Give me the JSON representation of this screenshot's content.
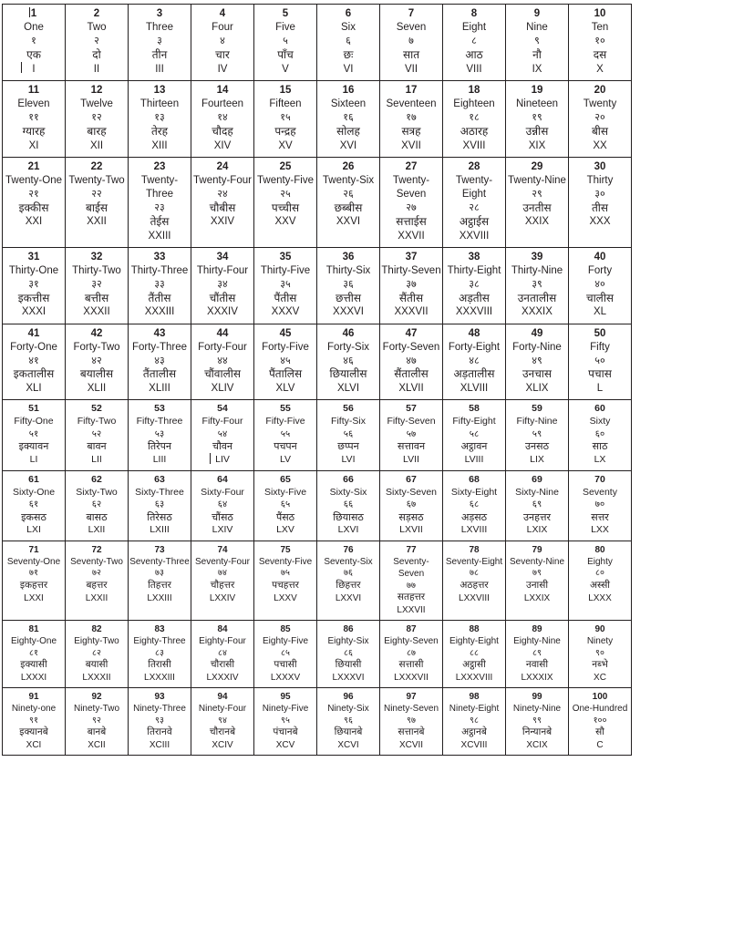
{
  "document": {
    "title": "Numbers 1 to 100 — English, Devanagari, Hindi, Roman",
    "columns_per_row": 10,
    "lines_per_cell": [
      "number",
      "english",
      "devanagari",
      "hindi",
      "roman"
    ]
  },
  "rows": [
    {
      "band": "s",
      "cells": [
        {
          "number": "1",
          "english": "One",
          "devanagari": "१",
          "hindi": "एक",
          "roman": "I",
          "caret": "number"
        },
        {
          "number": "2",
          "english": "Two",
          "devanagari": "२",
          "hindi": "दो",
          "roman": "II"
        },
        {
          "number": "3",
          "english": "Three",
          "devanagari": "३",
          "hindi": "तीन",
          "roman": "III"
        },
        {
          "number": "4",
          "english": "Four",
          "devanagari": "४",
          "hindi": "चार",
          "roman": "IV"
        },
        {
          "number": "5",
          "english": "Five",
          "devanagari": "५",
          "hindi": "पाँच",
          "roman": "V"
        },
        {
          "number": "6",
          "english": "Six",
          "devanagari": "६",
          "hindi": "छः",
          "roman": "VI"
        },
        {
          "number": "7",
          "english": "Seven",
          "devanagari": "७",
          "hindi": "सात",
          "roman": "VII"
        },
        {
          "number": "8",
          "english": "Eight",
          "devanagari": "८",
          "hindi": "आठ",
          "roman": "VIII"
        },
        {
          "number": "9",
          "english": "Nine",
          "devanagari": "९",
          "hindi": "नौ",
          "roman": "IX"
        },
        {
          "number": "10",
          "english": "Ten",
          "devanagari": "१०",
          "hindi": "दस",
          "roman": "X"
        }
      ]
    },
    {
      "band": "s",
      "cells": [
        {
          "number": "11",
          "english": "Eleven",
          "devanagari": "११",
          "hindi": "ग्यारह",
          "roman": "XI"
        },
        {
          "number": "12",
          "english": "Twelve",
          "devanagari": "१२",
          "hindi": "बारह",
          "roman": "XII"
        },
        {
          "number": "13",
          "english": "Thirteen",
          "devanagari": "१३",
          "hindi": "तेरह",
          "roman": "XIII"
        },
        {
          "number": "14",
          "english": "Fourteen",
          "devanagari": "१४",
          "hindi": "चौदह",
          "roman": "XIV"
        },
        {
          "number": "15",
          "english": "Fifteen",
          "devanagari": "१५",
          "hindi": "पन्द्रह",
          "roman": "XV"
        },
        {
          "number": "16",
          "english": "Sixteen",
          "devanagari": "१६",
          "hindi": "सोलह",
          "roman": "XVI"
        },
        {
          "number": "17",
          "english": "Seventeen",
          "devanagari": "१७",
          "hindi": "सत्रह",
          "roman": "XVII"
        },
        {
          "number": "18",
          "english": "Eighteen",
          "devanagari": "१८",
          "hindi": "अठारह",
          "roman": "XVIII"
        },
        {
          "number": "19",
          "english": "Nineteen",
          "devanagari": "१९",
          "hindi": "उन्नीस",
          "roman": "XIX"
        },
        {
          "number": "20",
          "english": "Twenty",
          "devanagari": "२०",
          "hindi": "बीस",
          "roman": "XX"
        }
      ]
    },
    {
      "band": "s",
      "cells": [
        {
          "number": "21",
          "english": "Twenty-One",
          "devanagari": "२१",
          "hindi": "इक्कीस",
          "roman": "XXI"
        },
        {
          "number": "22",
          "english": "Twenty-Two",
          "devanagari": "२२",
          "hindi": "बाईस",
          "roman": "XXII"
        },
        {
          "number": "23",
          "english": "Twenty-Three",
          "devanagari": "२३",
          "hindi": "तेईस",
          "roman": "XXIII"
        },
        {
          "number": "24",
          "english": "Twenty-Four",
          "devanagari": "२४",
          "hindi": "चौबीस",
          "roman": "XXIV"
        },
        {
          "number": "25",
          "english": "Twenty-Five",
          "devanagari": "२५",
          "hindi": "पच्चीस",
          "roman": "XXV"
        },
        {
          "number": "26",
          "english": "Twenty-Six",
          "devanagari": "२६",
          "hindi": "छब्बीस",
          "roman": "XXVI"
        },
        {
          "number": "27",
          "english": "Twenty-Seven",
          "devanagari": "२७",
          "hindi": "सत्ताईस",
          "roman": "XXVII"
        },
        {
          "number": "28",
          "english": "Twenty-Eight",
          "devanagari": "२८",
          "hindi": "अट्ठाईस",
          "roman": "XXVIII"
        },
        {
          "number": "29",
          "english": "Twenty-Nine",
          "devanagari": "२९",
          "hindi": "उनतीस",
          "roman": "XXIX"
        },
        {
          "number": "30",
          "english": "Thirty",
          "devanagari": "३०",
          "hindi": "तीस",
          "roman": "XXX"
        }
      ]
    },
    {
      "band": "s",
      "cells": [
        {
          "number": "31",
          "english": "Thirty-One",
          "devanagari": "३१",
          "hindi": "इकत्तीस",
          "roman": "XXXI"
        },
        {
          "number": "32",
          "english": "Thirty-Two",
          "devanagari": "३२",
          "hindi": "बत्तीस",
          "roman": "XXXII"
        },
        {
          "number": "33",
          "english": "Thirty-Three",
          "devanagari": "३३",
          "hindi": "तैंतीस",
          "roman": "XXXIII"
        },
        {
          "number": "34",
          "english": "Thirty-Four",
          "devanagari": "३४",
          "hindi": "चौंतीस",
          "roman": "XXXIV"
        },
        {
          "number": "35",
          "english": "Thirty-Five",
          "devanagari": "३५",
          "hindi": "पैंतीस",
          "roman": "XXXV"
        },
        {
          "number": "36",
          "english": "Thirty-Six",
          "devanagari": "३६",
          "hindi": "छत्तीस",
          "roman": "XXXVI"
        },
        {
          "number": "37",
          "english": "Thirty-Seven",
          "devanagari": "३७",
          "hindi": "सैंतीस",
          "roman": "XXXVII"
        },
        {
          "number": "38",
          "english": "Thirty-Eight",
          "devanagari": "३८",
          "hindi": "अड़तीस",
          "roman": "XXXVIII"
        },
        {
          "number": "39",
          "english": "Thirty-Nine",
          "devanagari": "३९",
          "hindi": "उनतालीस",
          "roman": "XXXIX"
        },
        {
          "number": "40",
          "english": "Forty",
          "devanagari": "४०",
          "hindi": "चालीस",
          "roman": "XL"
        }
      ]
    },
    {
      "band": "s",
      "cells": [
        {
          "number": "41",
          "english": "Forty-One",
          "devanagari": "४१",
          "hindi": "इकतालीस",
          "roman": "XLI"
        },
        {
          "number": "42",
          "english": "Forty-Two",
          "devanagari": "४२",
          "hindi": "बयालीस",
          "roman": "XLII"
        },
        {
          "number": "43",
          "english": "Forty-Three",
          "devanagari": "४३",
          "hindi": "तैंतालीस",
          "roman": "XLIII"
        },
        {
          "number": "44",
          "english": "Forty-Four",
          "devanagari": "४४",
          "hindi": "चौंवालीस",
          "roman": "XLIV"
        },
        {
          "number": "45",
          "english": "Forty-Five",
          "devanagari": "४५",
          "hindi": "पैंतालिस",
          "roman": "XLV"
        },
        {
          "number": "46",
          "english": "Forty-Six",
          "devanagari": "४६",
          "hindi": "छियालीस",
          "roman": "XLVI"
        },
        {
          "number": "47",
          "english": "Forty-Seven",
          "devanagari": "४७",
          "hindi": "सैंतालीस",
          "roman": "XLVII"
        },
        {
          "number": "48",
          "english": "Forty-Eight",
          "devanagari": "४८",
          "hindi": "अड़तालीस",
          "roman": "XLVIII"
        },
        {
          "number": "49",
          "english": "Forty-Nine",
          "devanagari": "४९",
          "hindi": "उनचास",
          "roman": "XLIX"
        },
        {
          "number": "50",
          "english": "Fifty",
          "devanagari": "५०",
          "hindi": "पचास",
          "roman": "L"
        }
      ]
    },
    {
      "band": "t",
      "cells": [
        {
          "number": "51",
          "english": "Fifty-One",
          "devanagari": "५१",
          "hindi": "इक्यावन",
          "roman": "LI"
        },
        {
          "number": "52",
          "english": "Fifty-Two",
          "devanagari": "५२",
          "hindi": "बावन",
          "roman": "LII"
        },
        {
          "number": "53",
          "english": "Fifty-Three",
          "devanagari": "५३",
          "hindi": "तिरेपन",
          "roman": "LIII"
        },
        {
          "number": "54",
          "english": "Fifty-Four",
          "devanagari": "५४",
          "hindi": "चौवन",
          "roman": "LIV",
          "caret": "roman"
        },
        {
          "number": "55",
          "english": "Fifty-Five",
          "devanagari": "५५",
          "hindi": "पचपन",
          "roman": "LV"
        },
        {
          "number": "56",
          "english": "Fifty-Six",
          "devanagari": "५६",
          "hindi": "छप्पन",
          "roman": "LVI"
        },
        {
          "number": "57",
          "english": "Fifty-Seven",
          "devanagari": "५७",
          "hindi": "सत्तावन",
          "roman": "LVII"
        },
        {
          "number": "58",
          "english": "Fifty-Eight",
          "devanagari": "५८",
          "hindi": "अट्ठावन",
          "roman": "LVIII"
        },
        {
          "number": "59",
          "english": "Fifty-Nine",
          "devanagari": "५९",
          "hindi": "उनसठ",
          "roman": "LIX"
        },
        {
          "number": "60",
          "english": "Sixty",
          "devanagari": "६०",
          "hindi": "साठ",
          "roman": "LX"
        }
      ]
    },
    {
      "band": "t",
      "cells": [
        {
          "number": "61",
          "english": "Sixty-One",
          "devanagari": "६१",
          "hindi": "इकसठ",
          "roman": "LXI"
        },
        {
          "number": "62",
          "english": "Sixty-Two",
          "devanagari": "६२",
          "hindi": "बासठ",
          "roman": "LXII"
        },
        {
          "number": "63",
          "english": "Sixty-Three",
          "devanagari": "६३",
          "hindi": "तिरेसठ",
          "roman": "LXIII"
        },
        {
          "number": "64",
          "english": "Sixty-Four",
          "devanagari": "६४",
          "hindi": "चौंसठ",
          "roman": "LXIV"
        },
        {
          "number": "65",
          "english": "Sixty-Five",
          "devanagari": "६५",
          "hindi": "पैंसठ",
          "roman": "LXV"
        },
        {
          "number": "66",
          "english": "Sixty-Six",
          "devanagari": "६६",
          "hindi": "छियासठ",
          "roman": "LXVI"
        },
        {
          "number": "67",
          "english": "Sixty-Seven",
          "devanagari": "६७",
          "hindi": "सड़सठ",
          "roman": "LXVII"
        },
        {
          "number": "68",
          "english": "Sixty-Eight",
          "devanagari": "६८",
          "hindi": "अड़सठ",
          "roman": "LXVIII"
        },
        {
          "number": "69",
          "english": "Sixty-Nine",
          "devanagari": "६९",
          "hindi": "उनहत्तर",
          "roman": "LXIX"
        },
        {
          "number": "70",
          "english": "Seventy",
          "devanagari": "७०",
          "hindi": "सत्तर",
          "roman": "LXX"
        }
      ]
    },
    {
      "band": "r",
      "cells": [
        {
          "number": "71",
          "english": "Seventy-One",
          "devanagari": "७१",
          "hindi": "इकहत्तर",
          "roman": "LXXI"
        },
        {
          "number": "72",
          "english": "Seventy-Two",
          "devanagari": "७२",
          "hindi": "बहत्तर",
          "roman": "LXXII"
        },
        {
          "number": "73",
          "english": "Seventy-Three",
          "devanagari": "७३",
          "hindi": "तिहत्तर",
          "roman": "LXXIII"
        },
        {
          "number": "74",
          "english": "Seventy-Four",
          "devanagari": "७४",
          "hindi": "चौहत्तर",
          "roman": "LXXIV"
        },
        {
          "number": "75",
          "english": "Seventy-Five",
          "devanagari": "७५",
          "hindi": "पचहत्तर",
          "roman": "LXXV"
        },
        {
          "number": "76",
          "english": "Seventy-Six",
          "devanagari": "७६",
          "hindi": "छिहत्तर",
          "roman": "LXXVI"
        },
        {
          "number": "77",
          "english": "Seventy-Seven",
          "devanagari": "७७",
          "hindi": "सतहत्तर",
          "roman": "LXXVII"
        },
        {
          "number": "78",
          "english": "Seventy-Eight",
          "devanagari": "७८",
          "hindi": "अठहत्तर",
          "roman": "LXXVIII"
        },
        {
          "number": "79",
          "english": "Seventy-Nine",
          "devanagari": "७९",
          "hindi": "उनासी",
          "roman": "LXXIX"
        },
        {
          "number": "80",
          "english": "Eighty",
          "devanagari": "८०",
          "hindi": "अस्सी",
          "roman": "LXXX"
        }
      ]
    },
    {
      "band": "r",
      "cells": [
        {
          "number": "81",
          "english": "Eighty-One",
          "devanagari": "८१",
          "hindi": "इक्यासी",
          "roman": "LXXXI"
        },
        {
          "number": "82",
          "english": "Eighty-Two",
          "devanagari": "८२",
          "hindi": "बयासी",
          "roman": "LXXXII"
        },
        {
          "number": "83",
          "english": "Eighty-Three",
          "devanagari": "८३",
          "hindi": "तिरासी",
          "roman": "LXXXIII"
        },
        {
          "number": "84",
          "english": "Eighty-Four",
          "devanagari": "८४",
          "hindi": "चौरासी",
          "roman": "LXXXIV"
        },
        {
          "number": "85",
          "english": "Eighty-Five",
          "devanagari": "८५",
          "hindi": "पचासी",
          "roman": "LXXXV"
        },
        {
          "number": "86",
          "english": "Eighty-Six",
          "devanagari": "८६",
          "hindi": "छियासी",
          "roman": "LXXXVI"
        },
        {
          "number": "87",
          "english": "Eighty-Seven",
          "devanagari": "८७",
          "hindi": "सत्तासी",
          "roman": "LXXXVII"
        },
        {
          "number": "88",
          "english": "Eighty-Eight",
          "devanagari": "८८",
          "hindi": "अट्ठासी",
          "roman": "LXXXVIII"
        },
        {
          "number": "89",
          "english": "Eighty-Nine",
          "devanagari": "८९",
          "hindi": "नवासी",
          "roman": "LXXXIX"
        },
        {
          "number": "90",
          "english": "Ninety",
          "devanagari": "९०",
          "hindi": "नब्भे",
          "roman": "XC"
        }
      ]
    },
    {
      "band": "r",
      "cells": [
        {
          "number": "91",
          "english": "Ninety-one",
          "devanagari": "९१",
          "hindi": "इक्यानबे",
          "roman": "XCI"
        },
        {
          "number": "92",
          "english": "Ninety-Two",
          "devanagari": "९२",
          "hindi": "बानबे",
          "roman": "XCII"
        },
        {
          "number": "93",
          "english": "Ninety-Three",
          "devanagari": "९३",
          "hindi": "तिरानवे",
          "roman": "XCIII"
        },
        {
          "number": "94",
          "english": "Ninety-Four",
          "devanagari": "९४",
          "hindi": "चौरानबे",
          "roman": "XCIV"
        },
        {
          "number": "95",
          "english": "Ninety-Five",
          "devanagari": "९५",
          "hindi": "पंचानबे",
          "roman": "XCV"
        },
        {
          "number": "96",
          "english": "Ninety-Six",
          "devanagari": "९६",
          "hindi": "छियानबे",
          "roman": "XCVI"
        },
        {
          "number": "97",
          "english": "Ninety-Seven",
          "devanagari": "९७",
          "hindi": "सत्तानबे",
          "roman": "XCVII"
        },
        {
          "number": "98",
          "english": "Ninety-Eight",
          "devanagari": "९८",
          "hindi": "अट्ठानबे",
          "roman": "XCVIII"
        },
        {
          "number": "99",
          "english": "Ninety-Nine",
          "devanagari": "९९",
          "hindi": "निन्यानबे",
          "roman": "XCIX"
        },
        {
          "number": "100",
          "english": "One-Hundred",
          "devanagari": "१००",
          "hindi": "सौ",
          "roman": "C"
        }
      ]
    }
  ]
}
